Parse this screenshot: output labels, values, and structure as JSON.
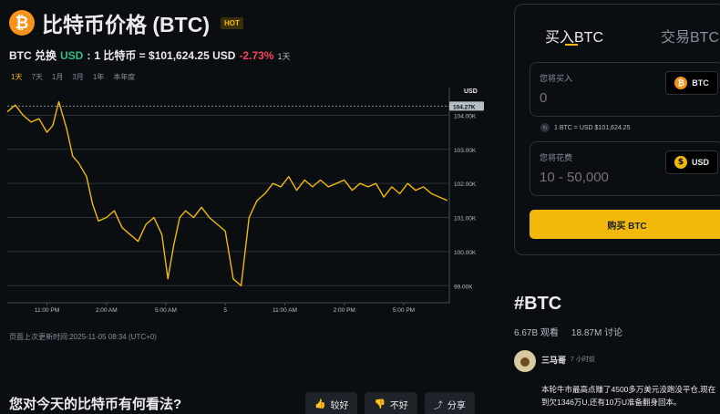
{
  "header": {
    "logo_glyph": "₿",
    "title": "比特币价格 (BTC)",
    "badge": "HOT"
  },
  "rate": {
    "pair_prefix": "BTC 兑换",
    "quote_currency": "USD",
    "colon": ":",
    "equation": "1 比特币 = $101,624.25 USD",
    "change": "-2.73%",
    "period": "1天"
  },
  "range_tabs": [
    "1天",
    "7天",
    "1月",
    "3月",
    "1年",
    "本年度"
  ],
  "chart_data": {
    "type": "line",
    "ylabel": "USD",
    "ylim": [
      98500,
      104600
    ],
    "y_ticks": [
      99000,
      100000,
      101000,
      102000,
      103000,
      104000
    ],
    "y_tick_labels": [
      "99.00K",
      "100.00K",
      "101.00K",
      "102.00K",
      "103.00K",
      "104.00K"
    ],
    "x_tick_labels": [
      "11:00 PM",
      "2:00 AM",
      "5:00 AM",
      "5",
      "11:00 AM",
      "2:00 PM",
      "5:00 PM"
    ],
    "x_tick_positions": [
      2,
      5,
      8,
      11,
      14,
      17,
      20
    ],
    "xlim": [
      0,
      22.3
    ],
    "current_marker": {
      "value": 104270,
      "label": "104.27K"
    },
    "series": [
      {
        "color": "#f0b90b",
        "x": [
          0,
          0.4,
          0.8,
          1.2,
          1.6,
          2.0,
          2.3,
          2.6,
          3.0,
          3.3,
          3.6,
          4.0,
          4.3,
          4.6,
          5.0,
          5.4,
          5.8,
          6.2,
          6.6,
          7.0,
          7.4,
          7.8,
          8.1,
          8.4,
          8.7,
          9.0,
          9.4,
          9.8,
          10.2,
          10.6,
          11.0,
          11.4,
          11.8,
          12.2,
          12.6,
          13.0,
          13.4,
          13.8,
          14.2,
          14.6,
          15.0,
          15.4,
          15.8,
          16.2,
          16.6,
          17.0,
          17.4,
          17.8,
          18.2,
          18.6,
          19.0,
          19.4,
          19.8,
          20.2,
          20.6,
          21.0,
          21.4,
          21.8,
          22.2
        ],
        "y": [
          104100,
          104300,
          104000,
          103800,
          103900,
          103500,
          103700,
          104400,
          103600,
          102800,
          102600,
          102200,
          101400,
          100900,
          101000,
          101200,
          100700,
          100500,
          100300,
          100800,
          101000,
          100500,
          99200,
          100200,
          101000,
          101200,
          101000,
          101300,
          101000,
          100800,
          100600,
          99200,
          99000,
          101000,
          101500,
          101700,
          102000,
          101900,
          102200,
          101800,
          102100,
          101900,
          102100,
          101900,
          102000,
          102100,
          101800,
          102000,
          101900,
          102000,
          101600,
          101900,
          101700,
          102000,
          101800,
          101900,
          101700,
          101600,
          101500
        ]
      }
    ]
  },
  "updated_text": "页面上次更新时间:2025-11-05 08:34 (UTC+0)",
  "question": "您对今天的比特币有何看法?",
  "vote": {
    "good": "较好",
    "bad": "不好",
    "share": "分享"
  },
  "trade": {
    "tab_buy": "买入BTC",
    "tab_trade": "交易BTC",
    "buy_label": "您将买入",
    "buy_value": "0",
    "buy_currency": "BTC",
    "rate_note": "1 BTC = USD $101,624.25",
    "spend_label": "您将花费",
    "spend_placeholder": "10 - 50,000",
    "spend_currency": "USD",
    "buy_button": "购买 BTC"
  },
  "tag": {
    "title": "#BTC",
    "views": "6.67B 观看",
    "discussions": "18.87M 讨论"
  },
  "post": {
    "author": "三马哥",
    "time": "7 小时前",
    "text": "本轮牛市最高点赚了4500多万美元没跑没平仓,现在到欠1346万U,还有10万U准备翻身回本。"
  },
  "colors": {
    "accent": "#f0b90b",
    "up": "#2ebd85",
    "down": "#f6465d",
    "background": "#0b0e11"
  },
  "icons": {
    "thumbs_up": "thumbs-up-icon",
    "thumbs_down": "thumbs-down-icon",
    "share": "share-icon",
    "bitcoin": "bitcoin-icon",
    "dollar": "dollar-icon"
  }
}
